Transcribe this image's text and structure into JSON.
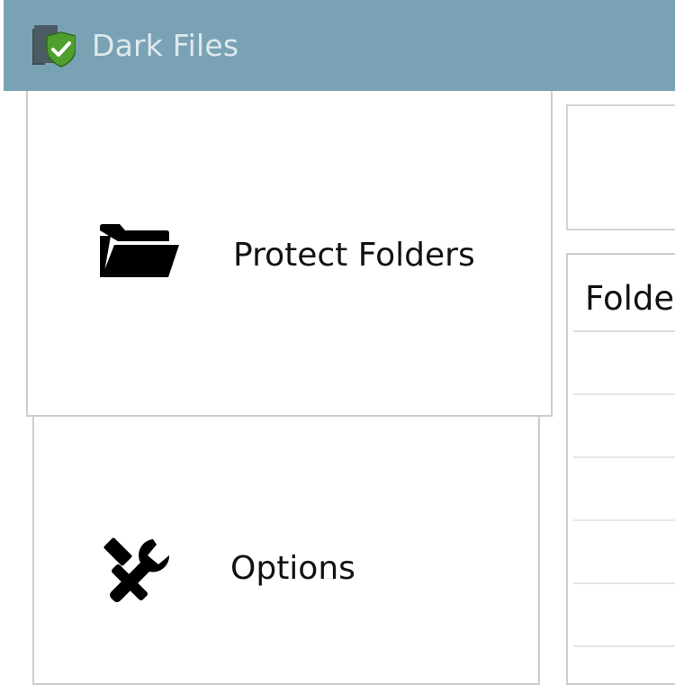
{
  "window": {
    "title": "Dark Files",
    "icon": "shield-check-icon",
    "titlebar_color": "#79a3b4"
  },
  "nav": {
    "items": [
      {
        "label": "Protect Folders",
        "icon": "folder-open-icon"
      },
      {
        "label": "Options",
        "icon": "tools-icon"
      }
    ]
  },
  "folder_list": {
    "column_header": "Folde",
    "rows": [
      "",
      "",
      "",
      "",
      ""
    ]
  }
}
